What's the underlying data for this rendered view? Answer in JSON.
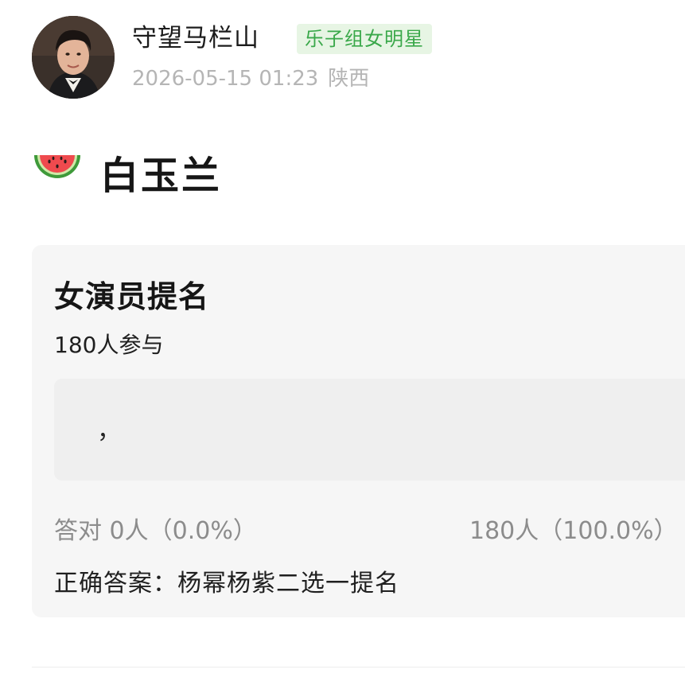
{
  "author": {
    "name": "守望马栏山",
    "badge": "乐子组女明星",
    "date": "2026-05-15 01:23",
    "location": "陕西"
  },
  "post": {
    "emoji": "watermelon-icon",
    "title": "白玉兰"
  },
  "quiz": {
    "title": "女演员提名",
    "participants": "180人参与",
    "option_text": "，",
    "correct_stat": "答对  0人（0.0%）",
    "other_stat": "180人（100.0%）",
    "answer": "正确答案：杨幂杨紫二选一提名"
  },
  "colors": {
    "badge_bg": "#e7f5e4",
    "badge_text": "#3aa84a",
    "card_bg": "#f6f6f6",
    "meta_text": "#b5b5b5"
  }
}
